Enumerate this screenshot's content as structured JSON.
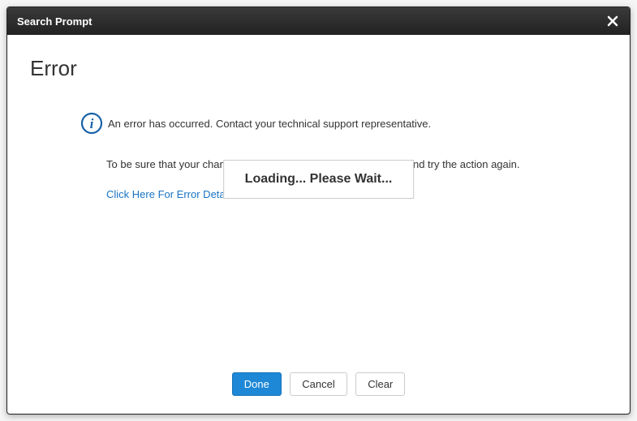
{
  "header": {
    "title": "Search Prompt"
  },
  "error": {
    "heading": "Error",
    "summary": "An error has occurred. Contact your technical support representative.",
    "detail": "To be sure that your change was not saved, you should go back and try the action again.",
    "link_label": "Click Here For Error Details"
  },
  "loading": {
    "text": "Loading... Please Wait..."
  },
  "footer": {
    "done_label": "Done",
    "cancel_label": "Cancel",
    "clear_label": "Clear"
  }
}
